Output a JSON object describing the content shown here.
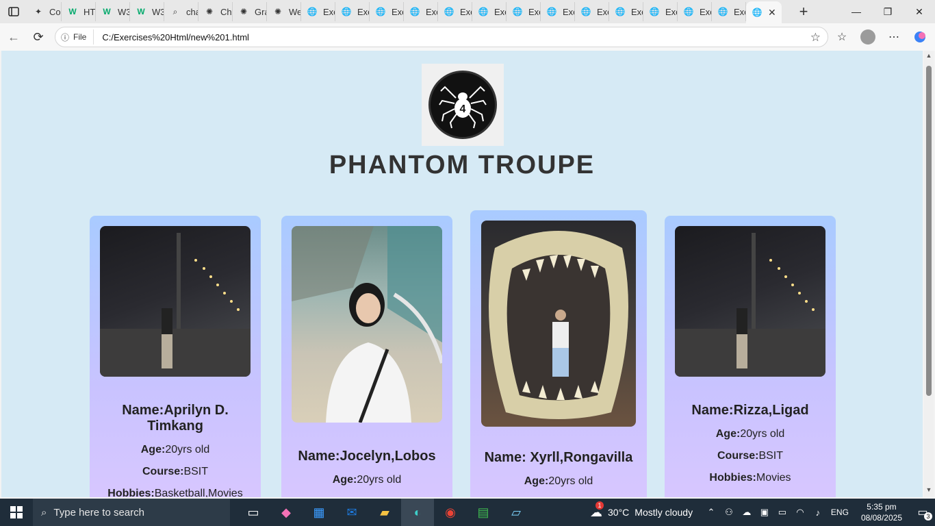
{
  "browser": {
    "tabs": [
      {
        "label": "Co",
        "icon": "copilot-icon"
      },
      {
        "label": "HT",
        "icon": "w3-icon"
      },
      {
        "label": "W3",
        "icon": "w3-icon"
      },
      {
        "label": "W3",
        "icon": "w3-icon"
      },
      {
        "label": "cha",
        "icon": "search-icon"
      },
      {
        "label": "Ch",
        "icon": "chatgpt-icon"
      },
      {
        "label": "Gra",
        "icon": "chatgpt-icon"
      },
      {
        "label": "We",
        "icon": "chatgpt-icon"
      },
      {
        "label": "Exe",
        "icon": "globe-icon"
      },
      {
        "label": "Exe",
        "icon": "globe-icon"
      },
      {
        "label": "Exe",
        "icon": "globe-icon"
      },
      {
        "label": "Exe",
        "icon": "globe-icon"
      },
      {
        "label": "Exe",
        "icon": "globe-icon"
      },
      {
        "label": "Exe",
        "icon": "globe-icon"
      },
      {
        "label": "Exe",
        "icon": "globe-icon"
      },
      {
        "label": "Exe",
        "icon": "globe-icon"
      },
      {
        "label": "Exe",
        "icon": "globe-icon"
      },
      {
        "label": "Exe",
        "icon": "globe-icon"
      },
      {
        "label": "Exe",
        "icon": "globe-icon"
      },
      {
        "label": "Exe",
        "icon": "globe-icon"
      },
      {
        "label": "Exe",
        "icon": "globe-icon"
      }
    ],
    "address": {
      "info_label": "File",
      "url": "C:/Exercises%20Html/new%201.html"
    }
  },
  "page": {
    "title": "PHANTOM TROUPE",
    "logo_digit": "4",
    "members": [
      {
        "name_label": "Name:",
        "name": "Aprilyn D. Timkang",
        "age_label": "Age:",
        "age": "20yrs old",
        "course_label": "Course:",
        "course": "BSIT",
        "hobbies_label": "Hobbies:",
        "hobbies": "Basketball,Movies"
      },
      {
        "name_label": "Name:",
        "name": "Jocelyn,Lobos",
        "age_label": "Age:",
        "age": "20yrs old"
      },
      {
        "name_label": "Name: ",
        "name": "Xyrll,Rongavilla",
        "age_label": "Age:",
        "age": "20yrs old"
      },
      {
        "name_label": "Name:",
        "name": "Rizza,Ligad",
        "age_label": "Age:",
        "age": "20yrs old",
        "course_label": "Course:",
        "course": "BSIT",
        "hobbies_label": "Hobbies:",
        "hobbies": "Movies"
      }
    ]
  },
  "taskbar": {
    "search_placeholder": "Type here to search",
    "weather": {
      "temp": "30°C",
      "condition": "Mostly cloudy",
      "alert_count": "1"
    },
    "language": "ENG",
    "time": "5:35 pm",
    "date": "08/08/2025",
    "notification_count": "3"
  }
}
